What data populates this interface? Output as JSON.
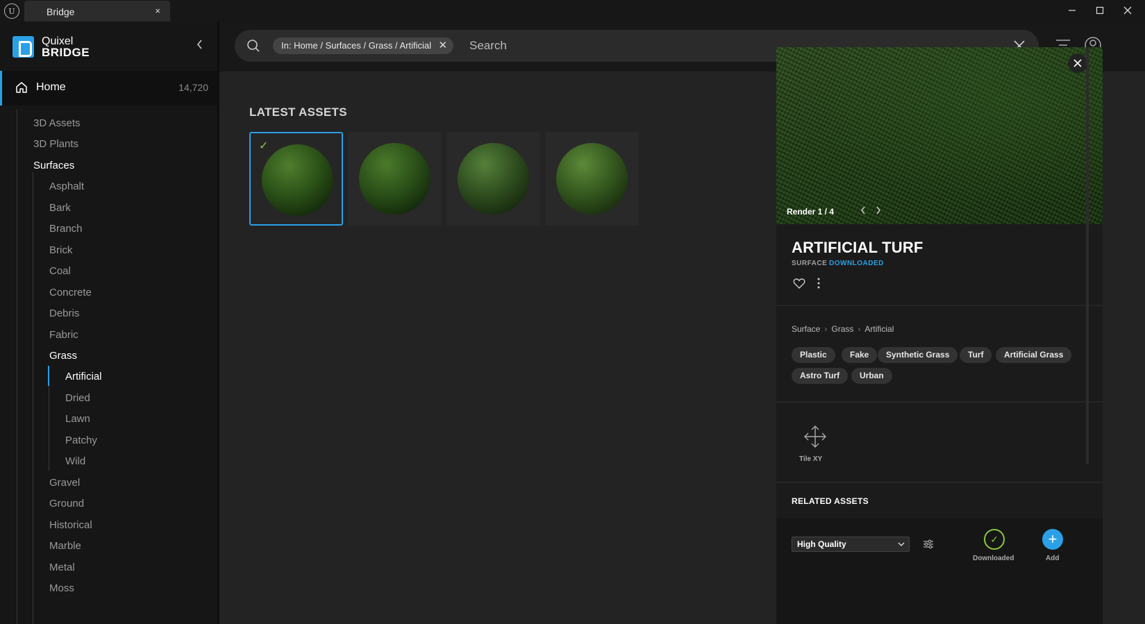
{
  "window": {
    "tab_title": "Bridge",
    "tab_close": "×"
  },
  "brand": {
    "line1": "Quixel",
    "line2": "BRIDGE"
  },
  "home": {
    "label": "Home",
    "count": "14,720"
  },
  "tree": {
    "top": [
      "3D Assets",
      "3D Plants",
      "Surfaces"
    ],
    "surfaces": [
      "Asphalt",
      "Bark",
      "Branch",
      "Brick",
      "Coal",
      "Concrete",
      "Debris",
      "Fabric",
      "Grass"
    ],
    "grass": [
      "Artificial",
      "Dried",
      "Lawn",
      "Patchy",
      "Wild"
    ],
    "surfaces_after": [
      "Gravel",
      "Ground",
      "Historical",
      "Marble",
      "Metal",
      "Moss"
    ]
  },
  "search": {
    "chip": "In: Home / Surfaces / Grass / Artificial",
    "placeholder": "Search"
  },
  "latest": {
    "title": "LATEST ASSETS",
    "check": "✓"
  },
  "detail": {
    "render_label": "Render 1 / 4",
    "title": "ARTIFICIAL TURF",
    "type": "SURFACE",
    "status": "DOWNLOADED",
    "breadcrumb": [
      "Surface",
      "Grass",
      "Artificial"
    ],
    "tags": [
      "Plastic",
      "Fake",
      "Synthetic Grass",
      "Turf",
      "Artificial Grass",
      "Astro Turf",
      "Urban"
    ],
    "tile_label": "Tile XY",
    "related_title": "RELATED ASSETS",
    "quality": "High Quality",
    "downloaded_label": "Downloaded",
    "add_label": "Add"
  },
  "colors": {
    "accent": "#2aa0e6",
    "downloaded": "#8cc63f"
  }
}
